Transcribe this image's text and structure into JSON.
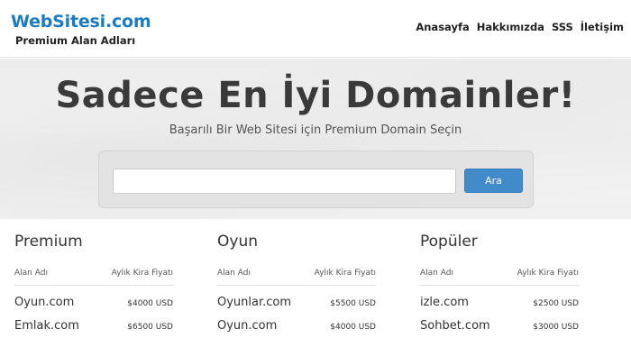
{
  "header": {
    "brand_name": "WebSitesi.com",
    "brand_sub": "Premium Alan Adları",
    "nav": [
      "Anasayfa",
      "Hakkımızda",
      "SSS",
      "İletişim"
    ]
  },
  "hero": {
    "title": "Sadece En İyi Domainler!",
    "subtitle": "Başarılı Bir Web Sitesi için Premium Domain Seçin",
    "search_value": "",
    "search_button": "Ara"
  },
  "columns": [
    {
      "title": "Premium",
      "head_name": "Alan Adı",
      "head_price": "Aylık Kira Fiyatı",
      "rows": [
        {
          "name": "Oyun.com",
          "price": "$4000 USD"
        },
        {
          "name": "Emlak.com",
          "price": "$6500 USD"
        }
      ]
    },
    {
      "title": "Oyun",
      "head_name": "Alan Adı",
      "head_price": "Aylık Kira Fiyatı",
      "rows": [
        {
          "name": "Oyunlar.com",
          "price": "$5500 USD"
        },
        {
          "name": "Oyun.com",
          "price": "$4000 USD"
        }
      ]
    },
    {
      "title": "Popüler",
      "head_name": "Alan Adı",
      "head_price": "Aylık Kira Fiyatı",
      "rows": [
        {
          "name": "izle.com",
          "price": "$2500 USD"
        },
        {
          "name": "Sohbet.com",
          "price": "$3000 USD"
        }
      ]
    }
  ],
  "colors": {
    "brand": "#1d7bc4",
    "button": "#428bca"
  }
}
